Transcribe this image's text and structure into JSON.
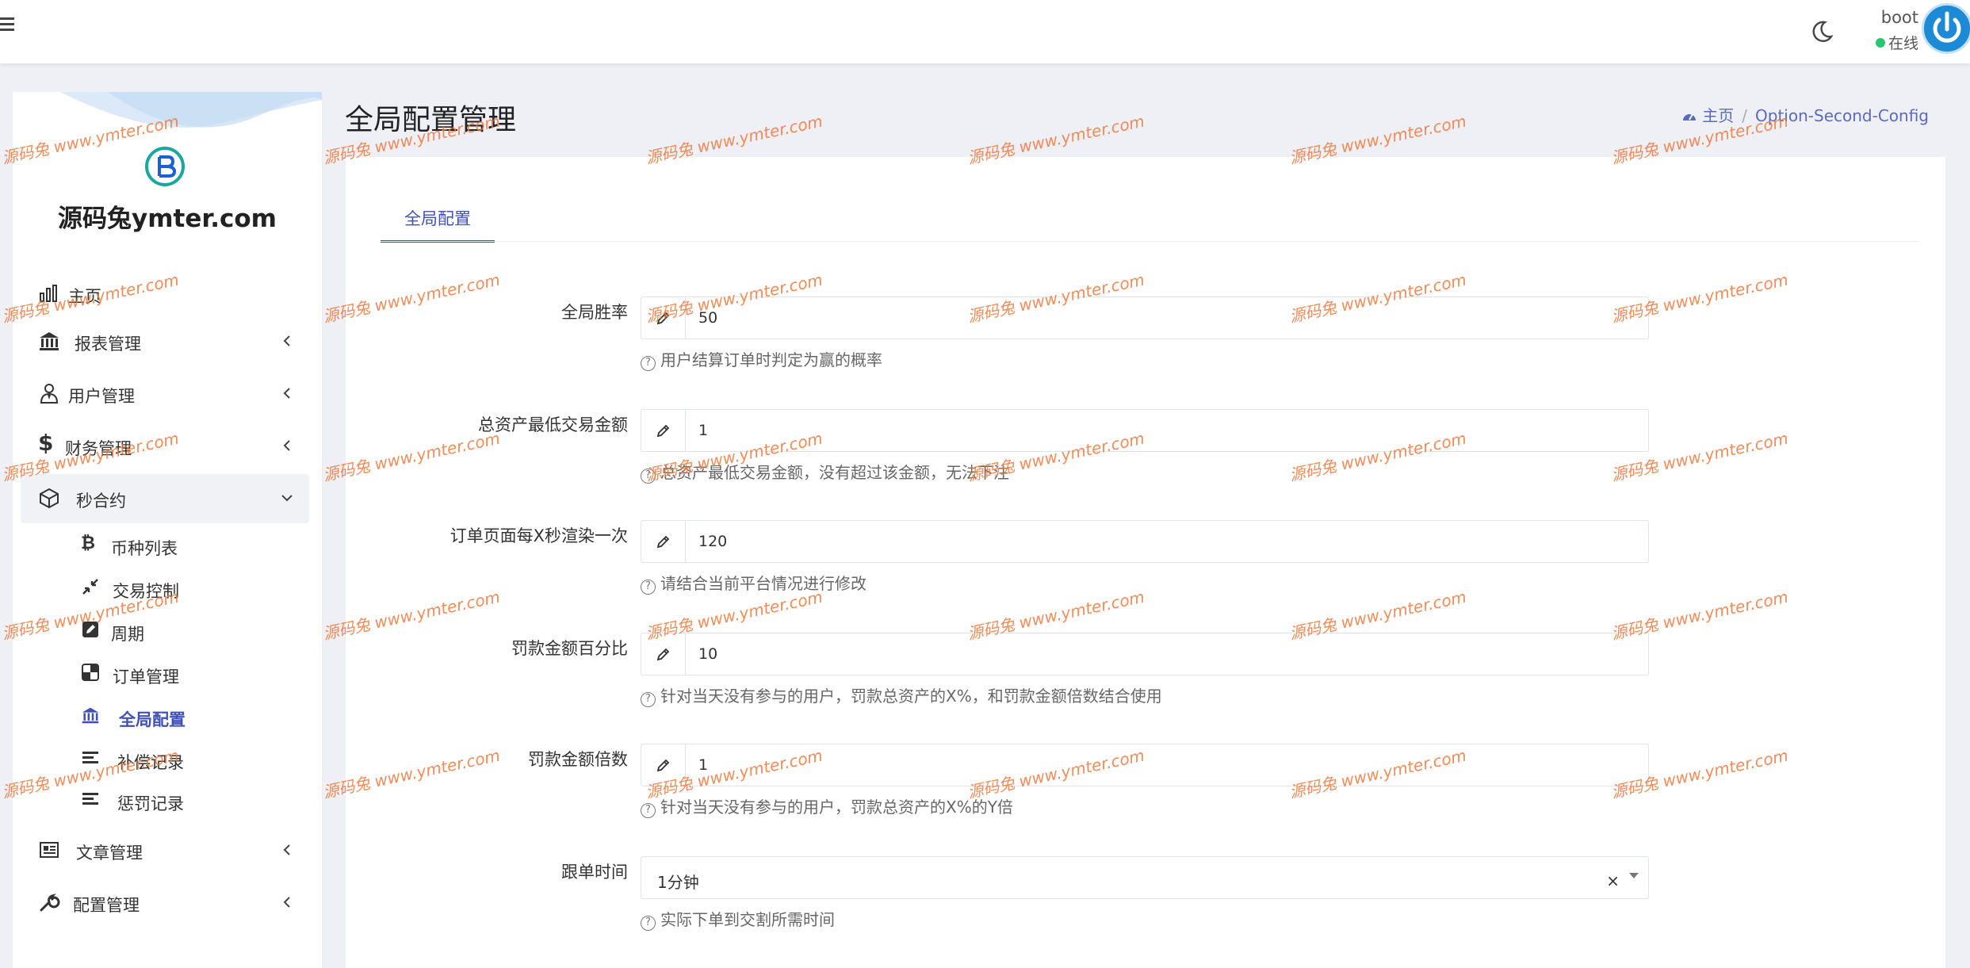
{
  "topbar": {
    "user_name": "boot",
    "user_status": "在线"
  },
  "brand": {
    "name": "源码兔ymter.com"
  },
  "sidebar": {
    "items": [
      {
        "label": "主页",
        "icon": "bar-chart-icon"
      },
      {
        "label": "报表管理",
        "icon": "bank-icon"
      },
      {
        "label": "用户管理",
        "icon": "user-tie-icon"
      },
      {
        "label": "财务管理",
        "icon": "dollar-icon"
      },
      {
        "label": "秒合约",
        "icon": "cube-icon"
      },
      {
        "label": "文章管理",
        "icon": "newspaper-icon"
      },
      {
        "label": "配置管理",
        "icon": "wrench-icon"
      }
    ],
    "sub_items": [
      {
        "label": "币种列表",
        "icon": "bitcoin-icon"
      },
      {
        "label": "交易控制",
        "icon": "compress-icon"
      },
      {
        "label": "周期",
        "icon": "edit-square-icon"
      },
      {
        "label": "订单管理",
        "icon": "checkered-icon"
      },
      {
        "label": "全局配置",
        "icon": "bank-icon"
      },
      {
        "label": "补偿记录",
        "icon": "align-left-icon"
      },
      {
        "label": "惩罚记录",
        "icon": "align-left-icon"
      }
    ]
  },
  "page": {
    "title": "全局配置管理",
    "breadcrumb_home": "主页",
    "breadcrumb_current": "Option-Second-Config"
  },
  "tab": {
    "label": "全局配置"
  },
  "fields": [
    {
      "label": "全局胜率",
      "value": "50",
      "help": "用户结算订单时判定为赢的概率"
    },
    {
      "label": "总资产最低交易金额",
      "value": "1",
      "help": "总资产最低交易金额，没有超过该金额，无法下注"
    },
    {
      "label": "订单页面每X秒渲染一次",
      "value": "120",
      "help": "请结合当前平台情况进行修改"
    },
    {
      "label": "罚款金额百分比",
      "value": "10",
      "help": "针对当天没有参与的用户，罚款总资产的X%，和罚款金额倍数结合使用"
    },
    {
      "label": "罚款金额倍数",
      "value": "1",
      "help": "针对当天没有参与的用户，罚款总资产的X%的Y倍"
    }
  ],
  "select_field": {
    "label": "跟单时间",
    "value": "1分钟",
    "clear": "×",
    "help": "实际下单到交割所需时间"
  },
  "watermark": {
    "text": "源码兔 www.ymter.com"
  },
  "colors": {
    "accent": "#3f51b5",
    "status_online": "#28c76f",
    "watermark": "#f0783c"
  }
}
